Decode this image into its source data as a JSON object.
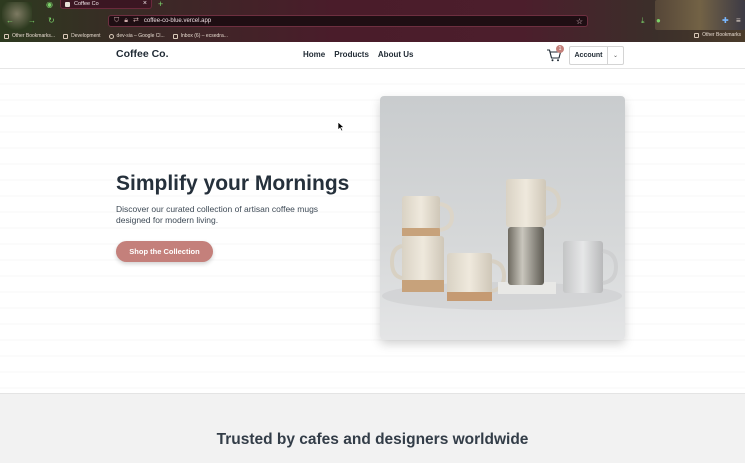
{
  "browser": {
    "tab_title": "Coffee Co",
    "url": "coffee-co-blue.vercel.app",
    "bookmarks": [
      "Other Bookmarks...",
      "Development",
      "dev-sia – Google Cl...",
      "Inbox (6) – ecsedra..."
    ],
    "bookmarks_right": "Other Bookmarks"
  },
  "site": {
    "logo": "Coffee Co.",
    "nav": [
      "Home",
      "Products",
      "About Us"
    ],
    "cart_count": "1",
    "account_label": "Account"
  },
  "hero": {
    "title": "Simplify your Mornings",
    "description": "Discover our curated collection of artisan coffee mugs designed for modern living.",
    "cta_label": "Shop the Collection"
  },
  "trusted": {
    "title": "Trusted by cafes and designers worldwide"
  },
  "colors": {
    "accent": "#c4807b",
    "text_dark": "#1f2933",
    "chrome_bg": "#4c1e2c"
  }
}
